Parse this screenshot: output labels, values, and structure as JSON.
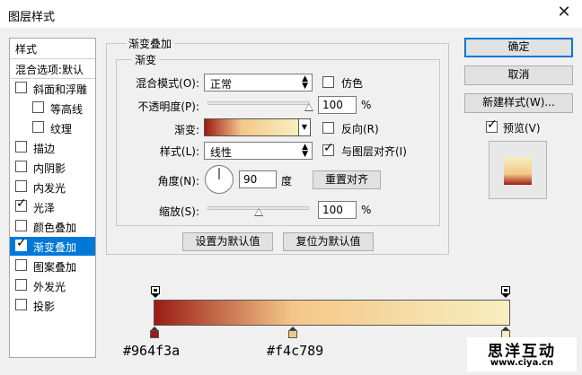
{
  "window": {
    "title": "图层样式"
  },
  "sidebar": {
    "header": "样式",
    "blend_options": "混合选项:默认",
    "items": [
      {
        "label": "斜面和浮雕",
        "checked": false,
        "indent": false
      },
      {
        "label": "等高线",
        "checked": false,
        "indent": true
      },
      {
        "label": "纹理",
        "checked": false,
        "indent": true
      },
      {
        "label": "描边",
        "checked": false,
        "indent": false
      },
      {
        "label": "内阴影",
        "checked": false,
        "indent": false
      },
      {
        "label": "内发光",
        "checked": false,
        "indent": false
      },
      {
        "label": "光泽",
        "checked": true,
        "indent": false
      },
      {
        "label": "颜色叠加",
        "checked": false,
        "indent": false
      },
      {
        "label": "渐变叠加",
        "checked": true,
        "indent": false,
        "selected": true
      },
      {
        "label": "图案叠加",
        "checked": false,
        "indent": false
      },
      {
        "label": "外发光",
        "checked": false,
        "indent": false
      },
      {
        "label": "投影",
        "checked": false,
        "indent": false
      }
    ]
  },
  "panel": {
    "group_title": "渐变叠加",
    "sub_title": "渐变",
    "blend_mode_label": "混合模式(O):",
    "blend_mode_value": "正常",
    "dither_label": "仿色",
    "opacity_label": "不透明度(P):",
    "opacity_value": "100",
    "percent": "%",
    "gradient_label": "渐变:",
    "reverse_label": "反向(R)",
    "style_label": "样式(L):",
    "style_value": "线性",
    "align_label": "与图层对齐(I)",
    "angle_label": "角度(N):",
    "angle_value": "90",
    "degree": "度",
    "reset_align": "重置对齐",
    "scale_label": "缩放(S):",
    "scale_value": "100",
    "set_default": "设置为默认值",
    "reset_default": "复位为默认值",
    "dither_checked": false,
    "reverse_checked": false,
    "align_checked": true,
    "opacity_fraction": 1.0,
    "scale_fraction": 0.5
  },
  "buttons": {
    "ok": "确定",
    "cancel": "取消",
    "new_style": "新建样式(W)...",
    "preview": "预览(V)",
    "preview_checked": true
  },
  "gradient": {
    "colors": [
      "#964f3a",
      "#f4c789",
      "#f7efc0"
    ],
    "midpoint_fraction": 0.39,
    "stop_labels": [
      "#964f3a",
      "#f4c789"
    ]
  },
  "colors": {
    "accent": "#0078d7",
    "dark_red": "#9b1c14",
    "gold": "#f4c789",
    "cream": "#f7f0bf"
  },
  "watermark": {
    "line1": "思洋互动",
    "line2": "www.ciya.cn"
  }
}
